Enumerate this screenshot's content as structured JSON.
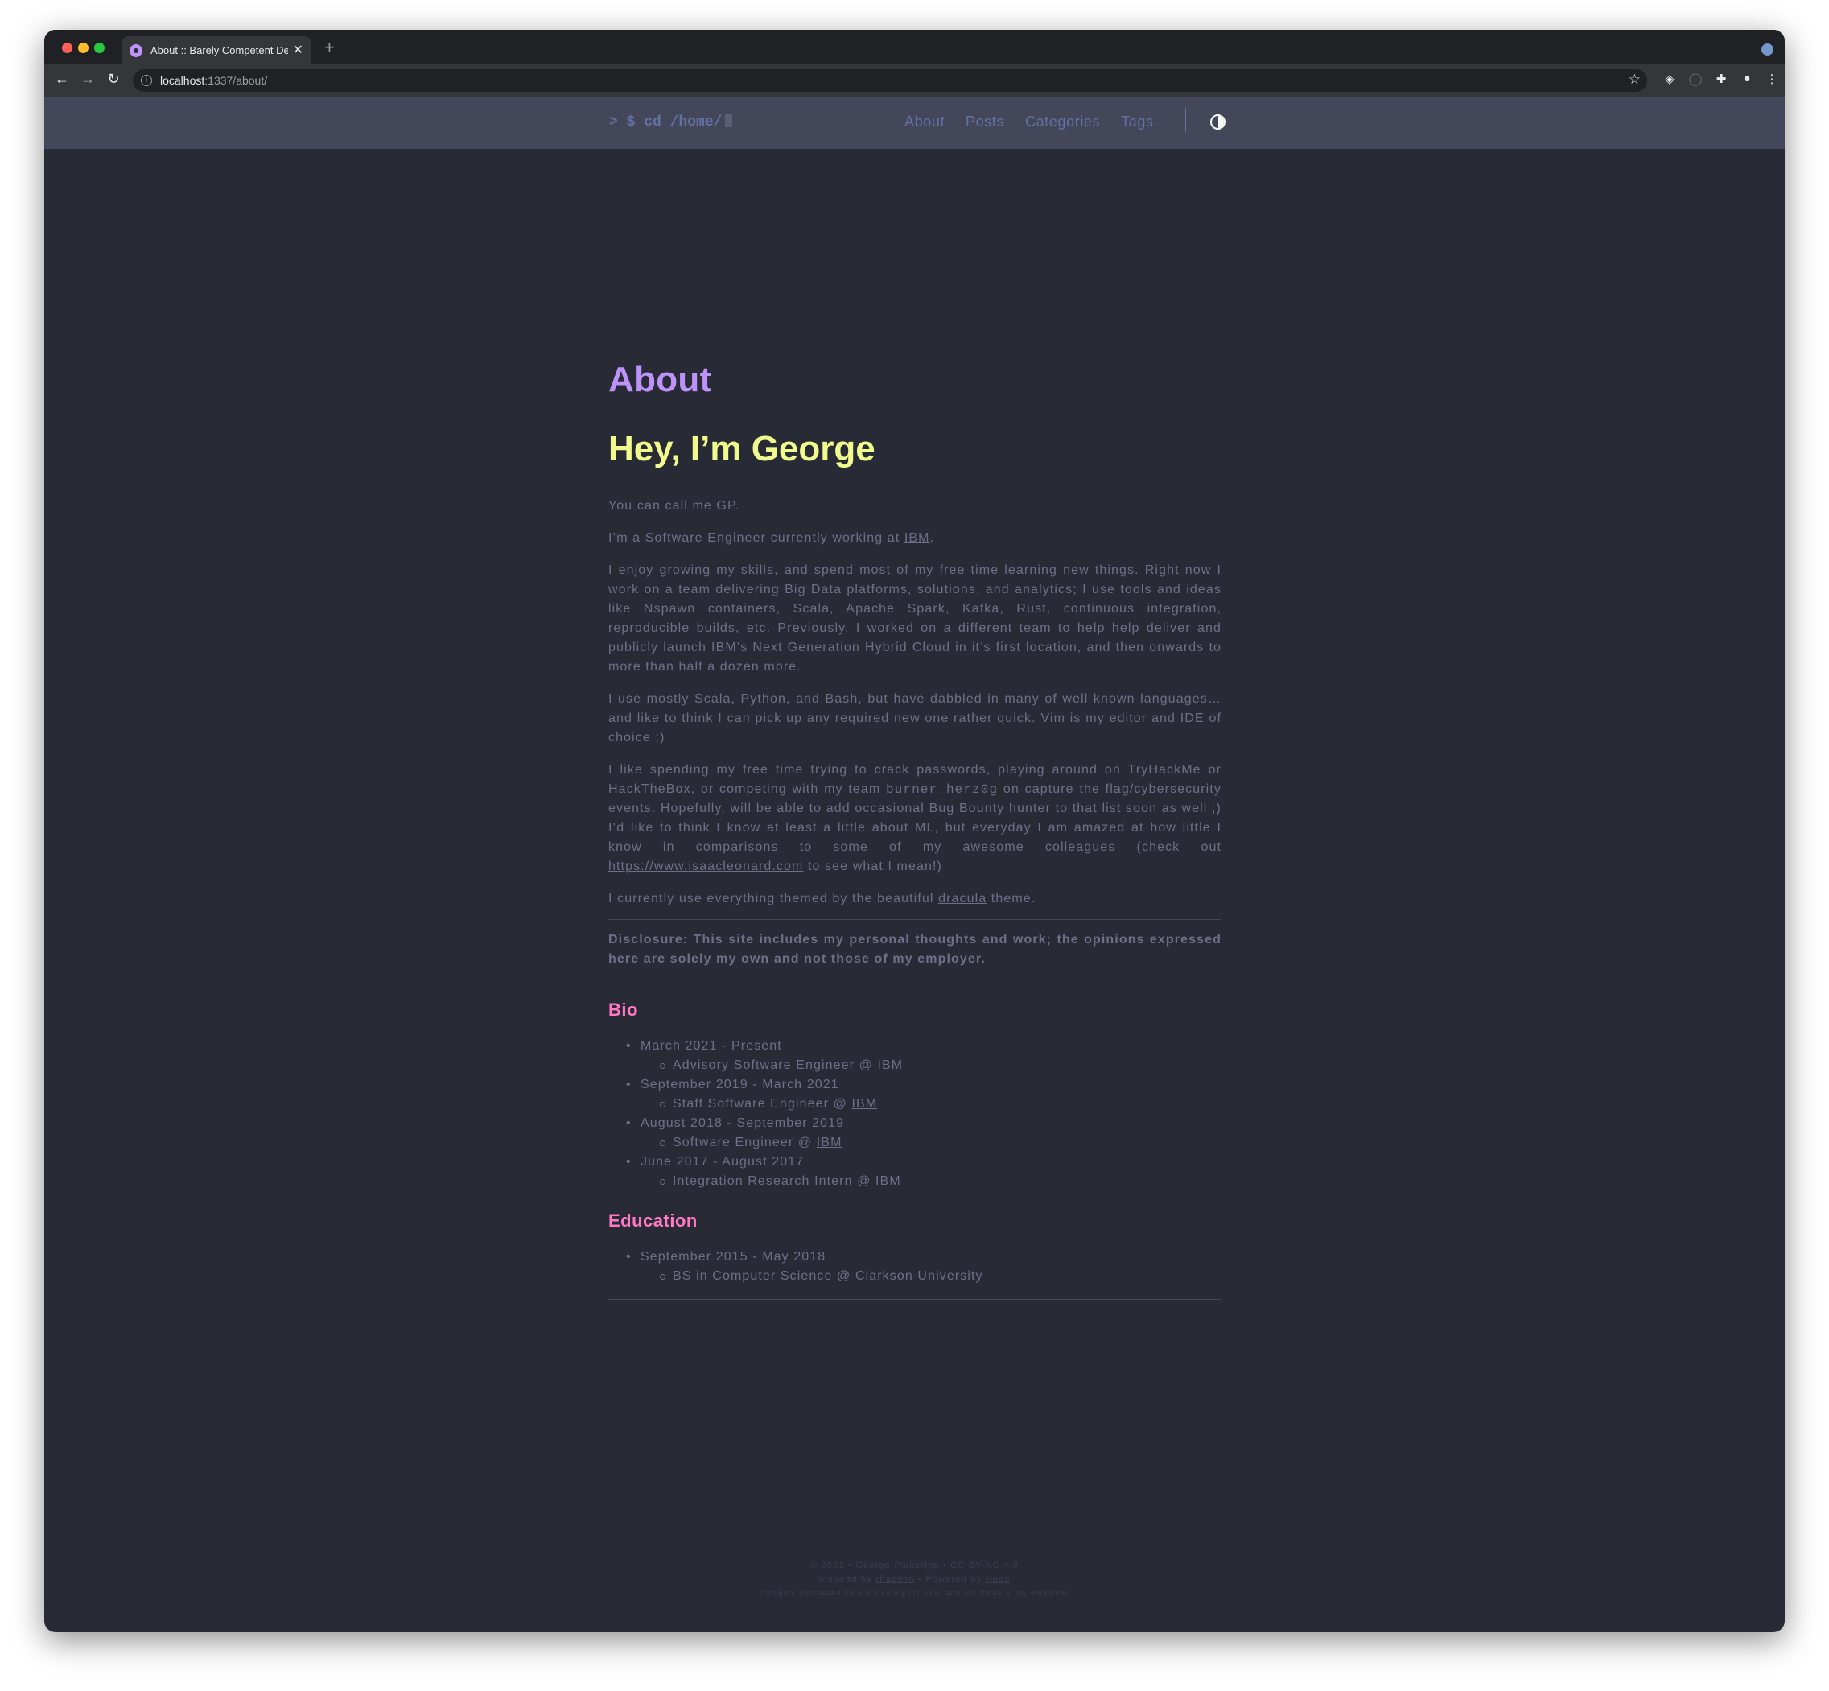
{
  "browser": {
    "tab_title": "About :: Barely Competent Dev",
    "url_host": "localhost",
    "url_path": ":1337/about/"
  },
  "site": {
    "logo_text": "> $ cd /home/",
    "menu": [
      "About",
      "Posts",
      "Categories",
      "Tags"
    ]
  },
  "page": {
    "title": "About",
    "heading": "Hey, I’m George",
    "p_callme": "You can call me GP.",
    "p_work_pre": "I’m a Software Engineer currently working at ",
    "p_work_link": "IBM",
    "p_work_post": ".",
    "p_skills": "I enjoy growing my skills, and spend most of my free time learning new things. Right now I work on a team delivering Big Data platforms, solutions, and analytics; I use tools and ideas like Nspawn containers, Scala, Apache Spark, Kafka, Rust, continuous integration, reproducible builds, etc. Previously, I worked on a different team to help help deliver and publicly launch IBM’s Next Generation Hybrid Cloud in it’s first location, and then onwards to more than half a dozen more.",
    "p_languages": "I use mostly Scala, Python, and Bash, but have dabbled in many of well known languages… and like to think I can pick up any required new one rather quick. Vim is my editor and IDE of choice ;)",
    "p_free_1": "I like spending my free time trying to crack passwords, playing around on TryHackMe or HackTheBox, or competing with my team ",
    "p_free_team": "burner_herz0g",
    "p_free_2": " on capture the flag/cybersecurity events. Hopefully, will be able to add occasional Bug Bounty hunter to that list soon as well ;) I’d like to think I know at least a little about ML, but everyday I am amazed at how little I know in comparisons to some of my awesome colleagues (check out ",
    "p_free_link": "https://www.isaacleonard.com",
    "p_free_3": " to see what I mean!)",
    "p_theme_pre": "I currently use everything themed by the beautiful ",
    "p_theme_link": "dracula",
    "p_theme_post": " theme.",
    "disclosure": "Disclosure: This site includes my personal thoughts and work; the opinions expressed here are solely my own and not those of my employer.",
    "bio_heading": "Bio",
    "bio": [
      {
        "period": "March 2021 - Present",
        "role": "Advisory Software Engineer @ ",
        "org": "IBM"
      },
      {
        "period": "September 2019 - March 2021",
        "role": "Staff Software Engineer @ ",
        "org": "IBM"
      },
      {
        "period": "August 2018 - September 2019",
        "role": "Software Engineer @ ",
        "org": "IBM"
      },
      {
        "period": "June 2017 - August 2017",
        "role": "Integration Research Intern @ ",
        "org": "IBM"
      }
    ],
    "education_heading": "Education",
    "education": [
      {
        "period": "September 2015 - May 2018",
        "role": "BS in Computer Science @ ",
        "org": "Clarkson University"
      }
    ]
  },
  "footer": {
    "copyright_pre": "© 2021 • ",
    "author": "George Pickering",
    "sep": " •  ",
    "license": "CC BY-NC 4.0",
    "inspired_pre": "Inspired by ",
    "inspired_link": "rhazdon",
    "powered_pre": " •  Powered by ",
    "powered_link": "Hugo",
    "thoughts": "Thoughts expressed here are solely my own, and not those of my employer."
  }
}
